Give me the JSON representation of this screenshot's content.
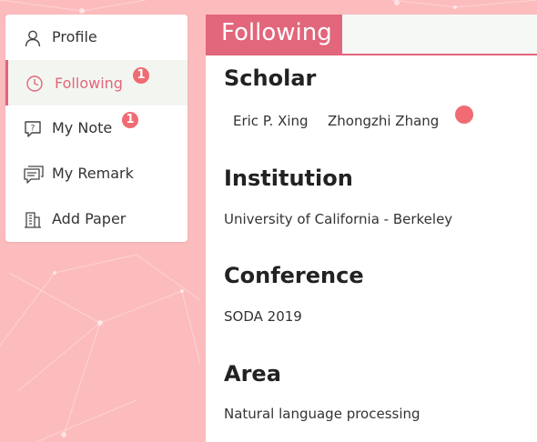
{
  "menu": {
    "items": [
      {
        "label": "Profile",
        "icon": "user-icon"
      },
      {
        "label": "Following",
        "icon": "clock-icon",
        "active": true,
        "badge": "1"
      },
      {
        "label": "My Note",
        "icon": "note-icon",
        "badge": "1"
      },
      {
        "label": "My Remark",
        "icon": "comment-icon"
      },
      {
        "label": "Add Paper",
        "icon": "building-icon"
      }
    ]
  },
  "main": {
    "tab_label": "Following",
    "sections": [
      {
        "title": "Scholar",
        "items": [
          "Eric P. Xing",
          "Zhongzhi Zhang"
        ]
      },
      {
        "title": "Institution",
        "text": "University of California - Berkeley"
      },
      {
        "title": "Conference",
        "text": "SODA 2019"
      },
      {
        "title": "Area",
        "text": "Natural language processing"
      }
    ]
  },
  "colors": {
    "accent": "#e2667c",
    "background": "#fcbcbd",
    "badge": "#f06b73",
    "active_item_bg": "#f3f6f0"
  }
}
